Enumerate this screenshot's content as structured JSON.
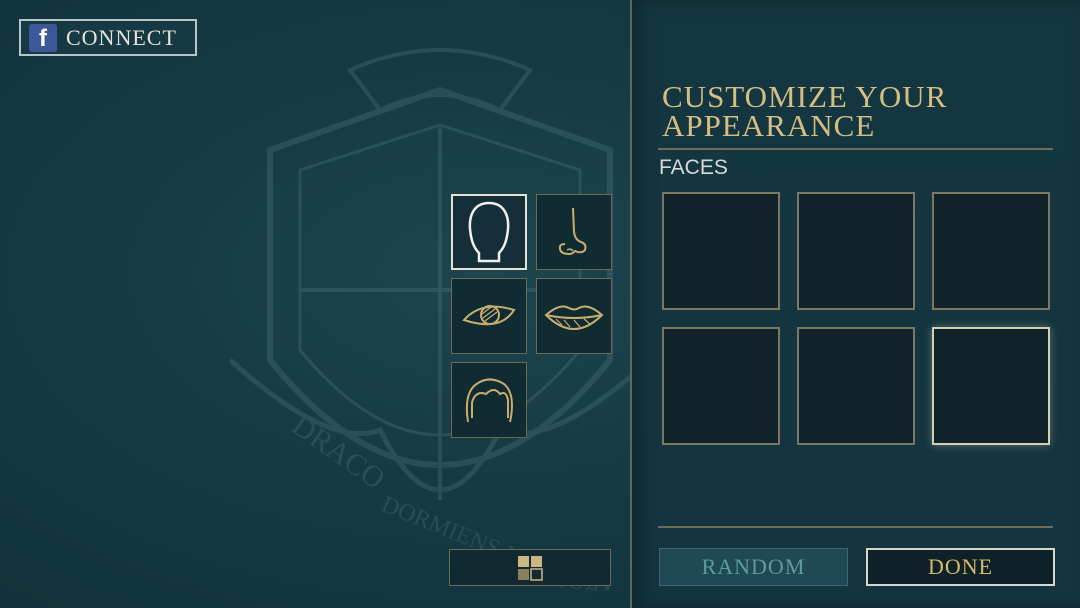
{
  "facebook": {
    "icon_glyph": "f",
    "label": "CONNECT"
  },
  "crest": {
    "motto_1": "DRACO",
    "motto_2": "DORMIENS NUNQUAM"
  },
  "features": [
    {
      "name": "face",
      "active": true
    },
    {
      "name": "nose",
      "active": false
    },
    {
      "name": "eye",
      "active": false
    },
    {
      "name": "lips",
      "active": false
    },
    {
      "name": "hair",
      "active": false
    }
  ],
  "panel": {
    "title_line1": "CUSTOMIZE YOUR",
    "title_line2": "APPEARANCE",
    "section_label": "FACES",
    "options_count": 6,
    "selected_option": 6
  },
  "buttons": {
    "random": "RANDOM",
    "done": "DONE"
  },
  "colors": {
    "gold": "#d6bd82",
    "panel": "#143640",
    "background": "#163a44",
    "facebook": "#3b5998",
    "random_text": "#5f9aa2"
  }
}
